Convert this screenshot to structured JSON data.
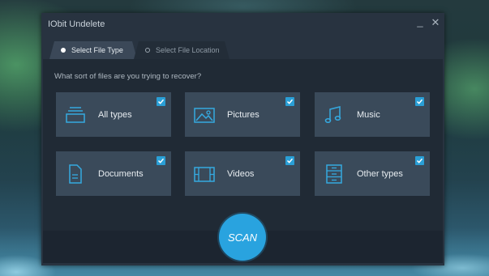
{
  "window": {
    "title": "IObit Undelete"
  },
  "controls": {
    "minimize": "_",
    "close": "✕"
  },
  "tabs": [
    {
      "label": "Select File Type",
      "active": true
    },
    {
      "label": "Select File Location",
      "active": false
    }
  ],
  "prompt": "What sort of files are you trying to recover?",
  "cards": [
    {
      "label": "All types",
      "icon": "stack-icon",
      "checked": true
    },
    {
      "label": "Pictures",
      "icon": "picture-icon",
      "checked": true
    },
    {
      "label": "Music",
      "icon": "music-note-icon",
      "checked": true
    },
    {
      "label": "Documents",
      "icon": "document-icon",
      "checked": true
    },
    {
      "label": "Videos",
      "icon": "film-icon",
      "checked": true
    },
    {
      "label": "Other types",
      "icon": "cabinet-icon",
      "checked": true
    }
  ],
  "scan_button": {
    "label": "SCAN"
  },
  "colors": {
    "accent": "#29a3df",
    "card": "#3a4a5a",
    "panel": "#202a35",
    "window": "#283340"
  }
}
